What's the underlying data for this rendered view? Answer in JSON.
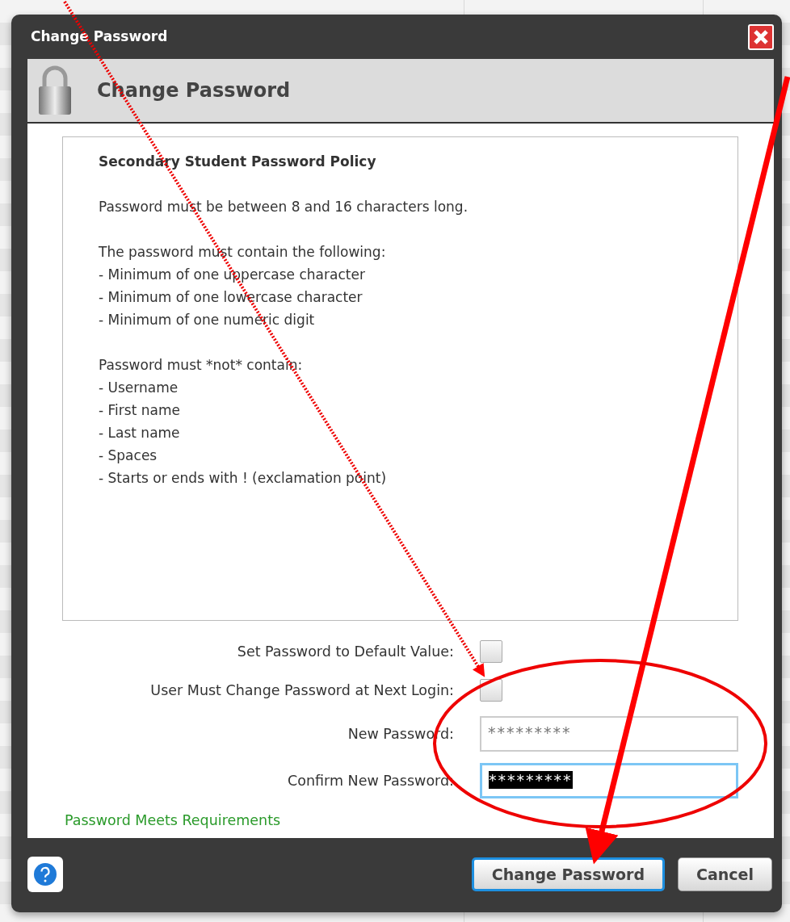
{
  "window": {
    "title": "Change Password"
  },
  "header": {
    "title": "Change Password"
  },
  "policy": {
    "title": "Secondary Student Password Policy",
    "paragraphs": [
      [
        "Password must be between 8 and 16 characters long."
      ],
      [
        "The password must contain the following:",
        "- Minimum of one uppercase character",
        "- Minimum of one lowercase character",
        "- Minimum of one numeric digit"
      ],
      [
        "Password must *not* contain:",
        "- Username",
        "- First name",
        "- Last name",
        "- Spaces",
        "- Starts or ends with ! (exclamation point)"
      ]
    ]
  },
  "options": [
    {
      "label": "Set Password to Default Value:",
      "checked": false
    },
    {
      "label": "User Must Change Password at Next Login:",
      "checked": false
    }
  ],
  "fields": [
    {
      "label": "New Password:",
      "value": "*********",
      "focused": false,
      "text_selected": false
    },
    {
      "label": "Confirm New Password:",
      "value": "*********",
      "focused": true,
      "text_selected": true
    }
  ],
  "status": "Password Meets Requirements",
  "buttons": [
    {
      "label": "Change Password",
      "focused": true
    },
    {
      "label": "Cancel",
      "focused": false
    }
  ]
}
